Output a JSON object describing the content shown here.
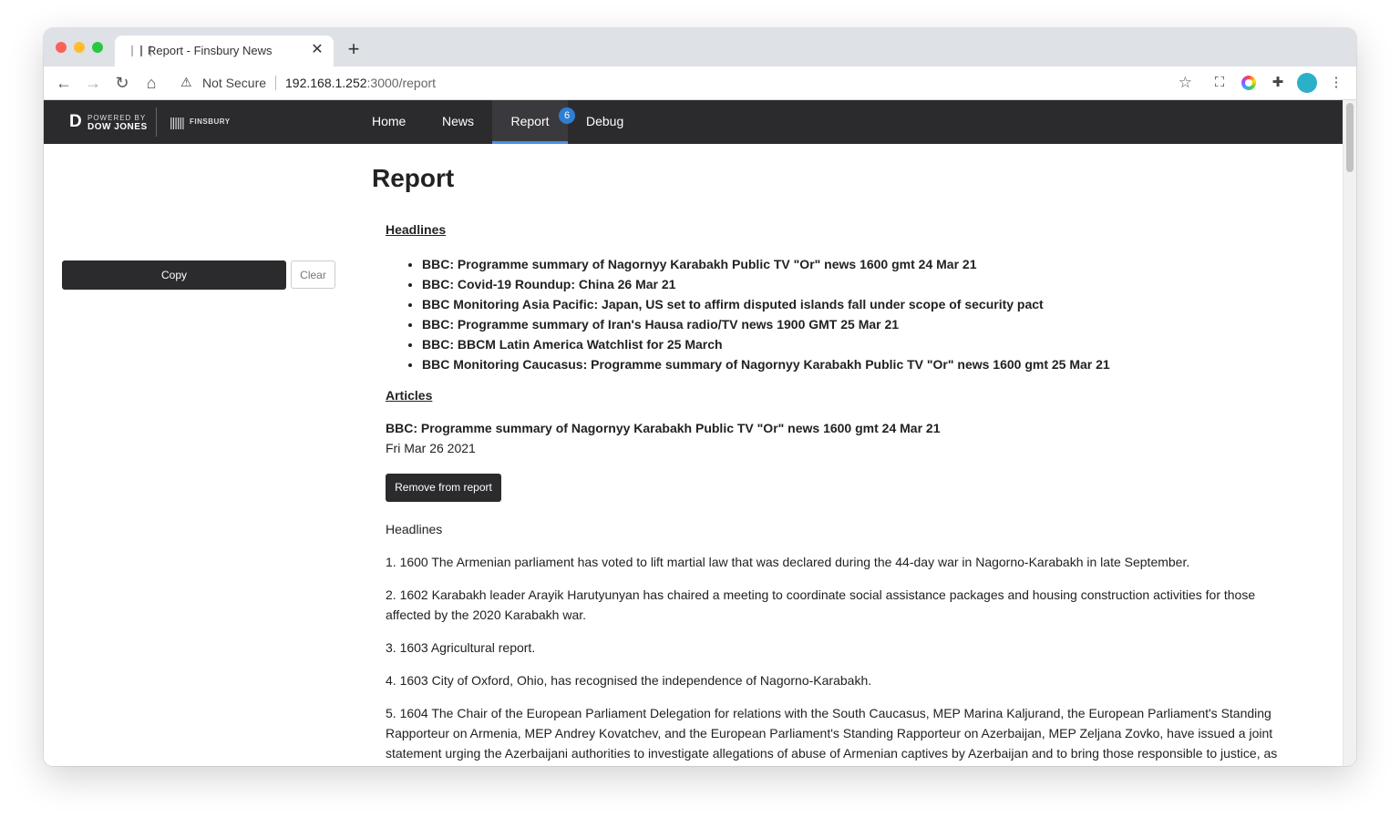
{
  "browser": {
    "tab_title": "Report - Finsbury News",
    "tab_close": "✕",
    "new_tab": "+",
    "security_status": "Not Secure",
    "url_host": "192.168.1.252",
    "url_rest": ":3000/report"
  },
  "app_nav": {
    "brand": {
      "mark": "D",
      "powered_by": "POWERED BY",
      "dow_jones": "DOW JONES",
      "partner": "FINSBURY"
    },
    "items": [
      {
        "label": "Home"
      },
      {
        "label": "News"
      },
      {
        "label": "Report",
        "badge": "6",
        "active": true
      },
      {
        "label": "Debug"
      }
    ],
    "colors": {
      "background": "#2b2b2e",
      "active_underline": "#4a90e2",
      "badge": "#2d7fd3"
    }
  },
  "sidebar": {
    "copy_label": "Copy",
    "clear_label": "Clear"
  },
  "main": {
    "title": "Report",
    "headlines_heading": "Headlines",
    "headlines": [
      "BBC: Programme summary of Nagornyy Karabakh Public TV \"Or\" news 1600 gmt 24 Mar 21",
      "BBC: Covid-19 Roundup: China 26 Mar 21",
      "BBC Monitoring Asia Pacific: Japan, US set to affirm disputed islands fall under scope of security pact",
      "BBC: Programme summary of Iran's Hausa radio/TV news 1900 GMT 25 Mar 21",
      "BBC: BBCM Latin America Watchlist for 25 March",
      "BBC Monitoring Caucasus: Programme summary of Nagornyy Karabakh Public TV \"Or\" news 1600 gmt 25 Mar 21"
    ],
    "articles_heading": "Articles",
    "article": {
      "title": "BBC: Programme summary of Nagornyy Karabakh Public TV \"Or\" news 1600 gmt 24 Mar 21",
      "date": "Fri Mar 26 2021",
      "remove_label": "Remove from report",
      "subheading": "Headlines",
      "paragraphs": [
        "1. 1600 The Armenian parliament has voted to lift martial law that was declared during the 44-day war in Nagorno-Karabakh in late September.",
        "2. 1602 Karabakh leader Arayik Harutyunyan has chaired a meeting to coordinate social assistance packages and housing construction activities for those affected by the 2020 Karabakh war.",
        "3. 1603 Agricultural report.",
        "4. 1603 City of Oxford, Ohio, has recognised the independence of Nagorno-Karabakh.",
        "5. 1604 The Chair of the European Parliament Delegation for relations with the South Caucasus, MEP Marina Kaljurand, the European Parliament's Standing Rapporteur on Armenia, MEP Andrey Kovatchev, and the European Parliament's Standing Rapporteur on Azerbaijan, MEP Zeljana Zovko, have issued a joint statement urging the Azerbaijani authorities to investigate allegations of abuse of Armenian captives by Azerbaijan and to bring those responsible to justice, as"
      ]
    }
  }
}
